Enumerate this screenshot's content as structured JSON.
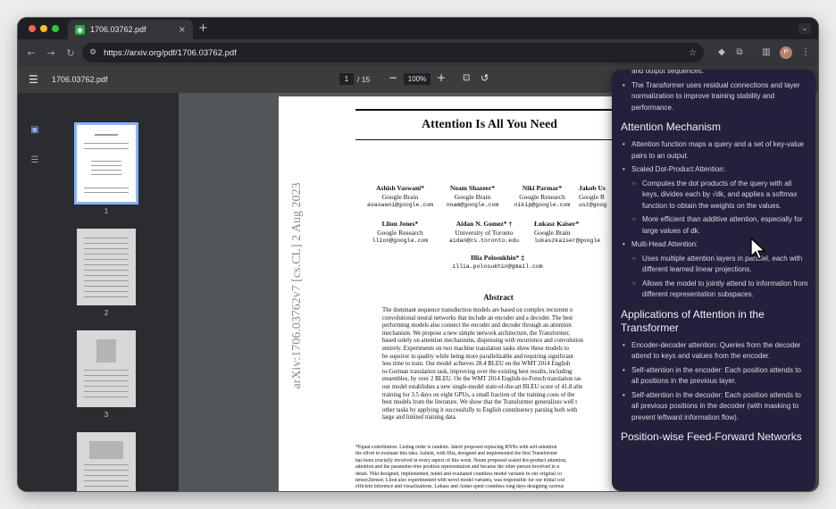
{
  "browser": {
    "tab_title": "1706.03762.pdf",
    "tab_favicon": "pdf-icon",
    "tab_close": "×",
    "new_tab": "+",
    "url": "https://arxiv.org/pdf/1706.03762.pdf",
    "nav": {
      "back": "←",
      "forward": "→",
      "reload": "↻"
    },
    "profile_initial": "P"
  },
  "viewer": {
    "menu": "☰",
    "file_name": "1706.03762.pdf",
    "page_current": "1",
    "page_total": "/ 15",
    "zoom": "100%",
    "zoom_out": "−",
    "zoom_in": "+",
    "thumbnails": [
      {
        "label": "1"
      },
      {
        "label": "2"
      },
      {
        "label": "3"
      },
      {
        "label": ""
      }
    ]
  },
  "paper": {
    "title": "Attention Is All You Need",
    "arxiv_stamp": "arXiv:1706.03762v7  [cs.CL]  2 Aug 2023",
    "authors": [
      {
        "name": "Ashish Vaswani*",
        "org": "Google Brain",
        "email": "avaswani@google.com"
      },
      {
        "name": "Noam Shazeer*",
        "org": "Google Brain",
        "email": "noam@google.com"
      },
      {
        "name": "Niki Parmar*",
        "org": "Google Research",
        "email": "nikip@google.com"
      },
      {
        "name": "Jakob Us",
        "org": "Google R",
        "email": "usz@goog"
      },
      {
        "name": "Llion Jones*",
        "org": "Google Research",
        "email": "llion@google.com"
      },
      {
        "name": "Aidan N. Gomez* †",
        "org": "University of Toronto",
        "email": "aidan@cs.toronto.edu"
      },
      {
        "name": "Łukasz Kaiser*",
        "org": "Google Brain",
        "email": "lukaszkaiser@google"
      },
      {
        "name": "Illia Polosukhin* ‡",
        "org": "",
        "email": "illia.polosukhin@gmail.com"
      }
    ],
    "abstract_heading": "Abstract",
    "abstract_lines": [
      "The dominant sequence transduction models are based on complex recurrent o",
      "convolutional neural networks that include an encoder and a decoder. The best",
      "performing models also connect the encoder and decoder through an attention",
      "mechanism. We propose a new simple network architecture, the Transformer,",
      "based solely on attention mechanisms, dispensing with recurrence and convolution",
      "entirely. Experiments on two machine translation tasks show these models to",
      "be superior in quality while being more parallelizable and requiring significant",
      "less time to train. Our model achieves 28.4 BLEU on the WMT 2014 English",
      "to-German translation task, improving over the existing best results, including",
      "ensembles, by over 2 BLEU. On the WMT 2014 English-to-French translation tas",
      "our model establishes a new single-model state-of-the-art BLEU score of 41.8 afte",
      "training for 3.5 days on eight GPUs, a small fraction of the training costs of the",
      "best models from the literature. We show that the Transformer generalizes well t",
      "other tasks by applying it successfully to English constituency parsing both with",
      "large and limited training data."
    ],
    "footnote_lines": [
      "*Equal contribution. Listing order is random. Jakob proposed replacing RNNs with self-attention",
      "the effort to evaluate this idea. Ashish, with Illia, designed and implemented the first Transformer",
      "has been crucially involved in every aspect of this work. Noam proposed scaled dot-product attention,",
      "attention and the parameter-free position representation and became the other person involved in n",
      "detail. Niki designed, implemented, tuned and evaluated countless model variants in our original co",
      "tensor2tensor. Llion also experimented with novel model variants, was responsible for our initial cod",
      "efficient inference and visualizations. Lukasz and Aidan spent countless long days designing various"
    ]
  },
  "ai_panel": {
    "top_items": [
      "and output sequences.",
      "The Transformer uses residual connections and layer normalization to improve training stability and performance."
    ],
    "sections": [
      {
        "heading": "Attention Mechanism",
        "items": [
          {
            "text": "Attention function maps a query and a set of key-value pairs to an output.",
            "sub": []
          },
          {
            "text": "Scaled Dot-Product Attention:",
            "sub": [
              "Computes the dot products of the query with all keys, divides each by √dk, and applies a softmax function to obtain the weights on the values.",
              "More efficient than additive attention, especially for large values of dk."
            ]
          },
          {
            "text": "Multi-Head Attention:",
            "sub": [
              "Uses multiple attention layers in parallel, each with different learned linear projections.",
              "Allows the model to jointly attend to information from different representation subspaces."
            ]
          }
        ]
      },
      {
        "heading": "Applications of Attention in the Transformer",
        "items": [
          {
            "text": "Encoder-decoder attention: Queries from the decoder attend to keys and values from the encoder.",
            "sub": []
          },
          {
            "text": "Self-attention in the encoder: Each position attends to all positions in the previous layer.",
            "sub": []
          },
          {
            "text": "Self-attention in the decoder: Each position attends to all previous positions in the decoder (with masking to prevent leftward information flow).",
            "sub": []
          }
        ]
      },
      {
        "heading": "Position-wise Feed-Forward Networks",
        "items": []
      }
    ]
  },
  "colors": {
    "panel_bg": "#22203a",
    "accent": "#8ab4f8",
    "canvas_bg": "#525659"
  }
}
